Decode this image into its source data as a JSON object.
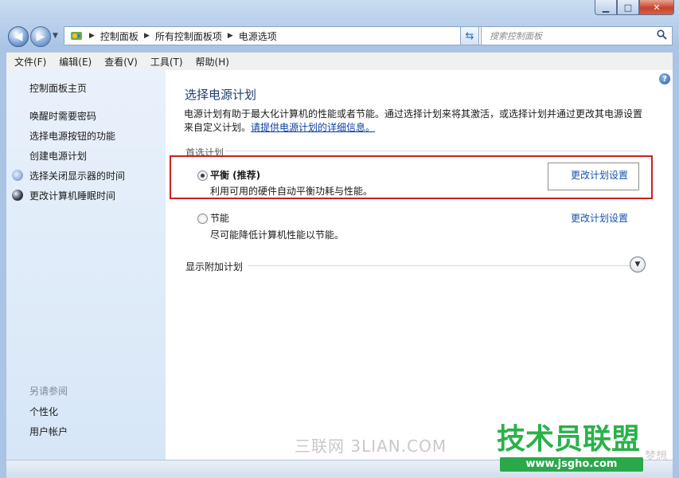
{
  "window": {
    "caption": {
      "minimize": "▁",
      "maximize": "□",
      "close": "✕"
    }
  },
  "nav": {
    "back_icon": "arrow-left-icon",
    "forward_icon": "arrow-right-icon",
    "breadcrumbs": [
      "控制面板",
      "所有控制面板项",
      "电源选项"
    ],
    "search_placeholder": "搜索控制面板"
  },
  "menu": [
    "文件(F)",
    "编辑(E)",
    "查看(V)",
    "工具(T)",
    "帮助(H)"
  ],
  "sidebar": {
    "home": "控制面板主页",
    "links": [
      {
        "label": "唤醒时需要密码"
      },
      {
        "label": "选择电源按钮的功能"
      },
      {
        "label": "创建电源计划"
      },
      {
        "label": "选择关闭显示器的时间",
        "icon": "monitor-icon"
      },
      {
        "label": "更改计算机睡眠时间",
        "icon": "moon-icon"
      }
    ],
    "see_also": "另请参阅",
    "see_also_links": [
      "个性化",
      "用户帐户"
    ]
  },
  "main": {
    "title": "选择电源计划",
    "desc_text": "电源计划有助于最大化计算机的性能或者节能。通过选择计划来将其激活，或选择计划并通过更改其电源设置来自定义计划。",
    "desc_link": "请提供电源计划的详细信息。",
    "group_label": "首选计划",
    "plans": [
      {
        "name": "平衡 (推荐)",
        "desc": "利用可用的硬件自动平衡功耗与性能。",
        "selected": true,
        "link": "更改计划设置"
      },
      {
        "name": "节能",
        "desc": "尽可能降低计算机性能以节能。",
        "selected": false,
        "link": "更改计划设置"
      }
    ],
    "more_plans": "显示附加计划",
    "highlight_color": "#cc1f1f"
  },
  "watermarks": {
    "left": "三联网 3LIAN.COM",
    "logo": "技术员联盟",
    "url": "www.jsgho.com",
    "side": "梦想"
  }
}
